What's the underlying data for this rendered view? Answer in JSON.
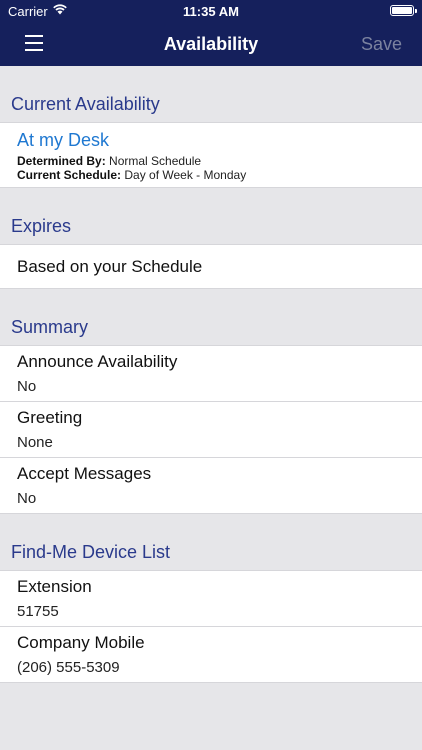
{
  "status_bar": {
    "carrier": "Carrier",
    "time": "11:35 AM",
    "icons": [
      "wifi-icon",
      "battery-icon"
    ]
  },
  "nav": {
    "title": "Availability",
    "save_label": "Save",
    "menu_icon": "hamburger-menu-icon"
  },
  "colors": {
    "nav_bg": "#15205c",
    "section_header": "#2a3a8c",
    "availability_link": "#1f78d1",
    "background": "#e6e6e9"
  },
  "current_availability": {
    "header": "Current Availability",
    "status": "At my Desk",
    "determined_by_label": "Determined By:",
    "determined_by_value": "Normal Schedule",
    "current_schedule_label": "Current Schedule:",
    "current_schedule_value": "Day of Week - Monday"
  },
  "expires": {
    "header": "Expires",
    "value": "Based on your Schedule"
  },
  "summary": {
    "header": "Summary",
    "items": [
      {
        "title": "Announce Availability",
        "value": "No"
      },
      {
        "title": "Greeting",
        "value": "None"
      },
      {
        "title": "Accept Messages",
        "value": "No"
      }
    ]
  },
  "find_me": {
    "header": "Find-Me Device List",
    "items": [
      {
        "title": "Extension",
        "value": "51755"
      },
      {
        "title": "Company Mobile",
        "value": "(206) 555-5309"
      }
    ]
  }
}
